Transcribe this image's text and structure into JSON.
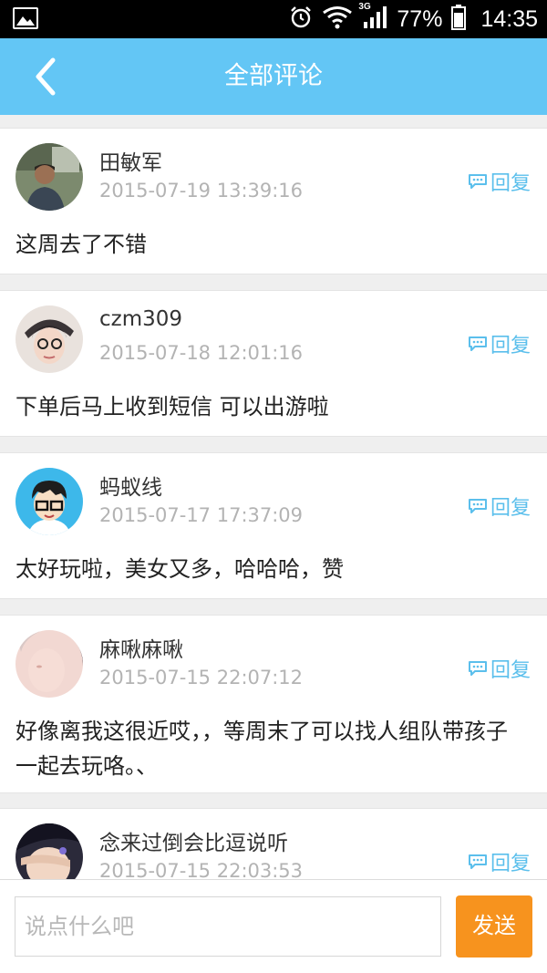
{
  "status_bar": {
    "battery_text": "77%",
    "time": "14:35",
    "network": "3G"
  },
  "header": {
    "title": "全部评论"
  },
  "comments": [
    {
      "name": "田敏军",
      "time": "2015-07-19 13:39:16",
      "content": "这周去了不错",
      "reply_label": "回复"
    },
    {
      "name": "czm309",
      "time": "2015-07-18 12:01:16",
      "content": "下单后马上收到短信 可以出游啦",
      "reply_label": "回复"
    },
    {
      "name": "蚂蚁线",
      "time": "2015-07-17 17:37:09",
      "content": "太好玩啦，美女又多，哈哈哈，赞",
      "reply_label": "回复"
    },
    {
      "name": "麻啾麻啾",
      "time": "2015-07-15 22:07:12",
      "content": "好像离我这很近哎，，等周末了可以找人组队带孩子一起去玩咯。、",
      "reply_label": "回复"
    },
    {
      "name": "念来过倒会比逗说听",
      "time": "2015-07-15 22:03:53",
      "content": "",
      "reply_label": "回复"
    }
  ],
  "composer": {
    "placeholder": "说点什么吧",
    "send_label": "发送"
  },
  "colors": {
    "header_bg": "#63c6f5",
    "accent": "#5bbfec",
    "send_button": "#f7931e"
  }
}
